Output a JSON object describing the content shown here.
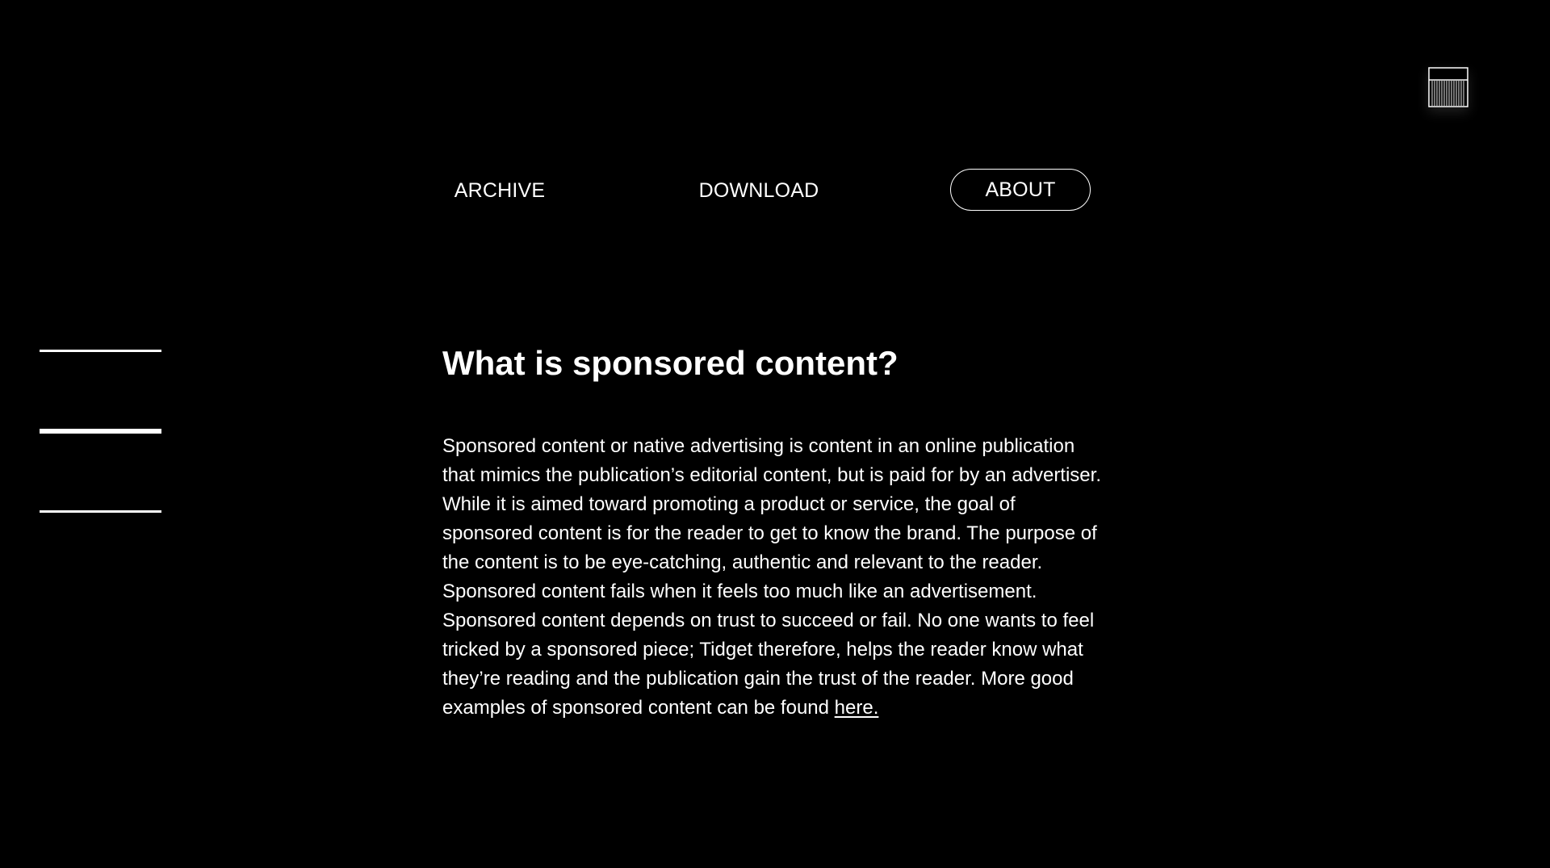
{
  "nav": {
    "archive_label": "ARCHIVE",
    "download_label": "DOWNLOAD",
    "about_label": "ABOUT",
    "active": "about"
  },
  "logo": {
    "icon": "barcode-box-icon"
  },
  "article": {
    "heading": "What is sponsored content?",
    "body_lines": [
      "Sponsored content or native advertising is content in an online publication",
      "that mimics the publication’s editorial content, but is paid for by an advertiser.",
      "While it is aimed toward promoting a product or service, the goal of",
      "sponsored content is for the reader to get to know the brand. The purpose of",
      "the content is to be eye-catching, authentic and relevant to the reader.",
      "Sponsored content fails when it feels too much like an advertisement.",
      "Sponsored content depends on trust to succeed or fail. No one wants to feel",
      "tricked by a sponsored piece; Tidget therefore, helps the reader know what",
      "they’re reading and the publication gain the trust of the reader. More good",
      "examples of sponsored content can be found "
    ],
    "link_text": "here."
  },
  "colors": {
    "background": "#000000",
    "text": "#ffffff"
  }
}
